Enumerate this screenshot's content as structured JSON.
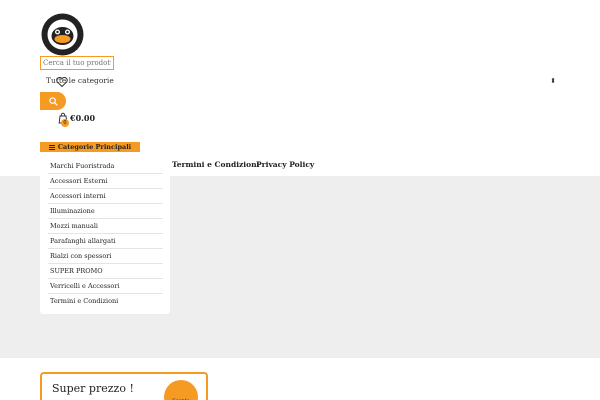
{
  "logo": {
    "icon": "duck-logo-icon"
  },
  "search": {
    "placeholder": "Cerca il tuo prodotto"
  },
  "category_select": {
    "selected": "Tutte le categorie"
  },
  "cart": {
    "count": "0",
    "total": "€0.00"
  },
  "categories_button": {
    "label": "Categorie Principali"
  },
  "nav": {
    "terms": "Termini e Condizioni",
    "privacy": "Privacy Policy"
  },
  "categories": [
    "Marchi Fuoristrada",
    "Accessori Esterni",
    "Accessori interni",
    "Illuminazione",
    "Mozzi manuali",
    "Parafanghi allargati",
    "Rialzi con spessori",
    "SUPER PROMO",
    "Verricelli e Accessori",
    "Termini e Condizioni"
  ],
  "promo": {
    "title": "Super prezzo !",
    "badge": "Sconto"
  },
  "colors": {
    "accent": "#f59a23",
    "band": "#eeeeee"
  }
}
